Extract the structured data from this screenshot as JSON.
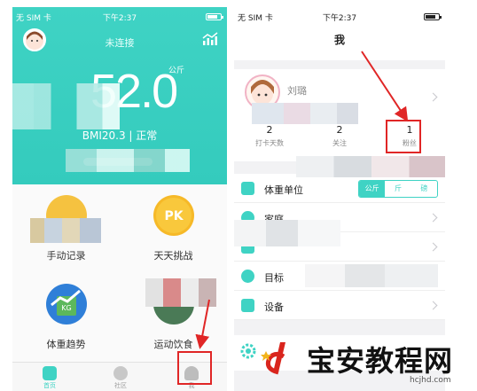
{
  "left": {
    "status": {
      "carrier": "无 SIM 卡",
      "time": "下午2:37"
    },
    "connection": "未连接",
    "weight": "52.0",
    "unit": "公斤",
    "bmi": "BMI20.3 | 正常",
    "grid": [
      {
        "label": "手动记录",
        "color": "#f5b830"
      },
      {
        "label": "天天挑战",
        "color": "#f2b122"
      },
      {
        "label": "体重趋势",
        "color": "#2f7fd8"
      },
      {
        "label": "运动饮食",
        "color": "#2f8f4a"
      }
    ],
    "tabs": [
      {
        "label": "首页",
        "active": true
      },
      {
        "label": "社区",
        "active": false
      },
      {
        "label": "我",
        "active": false
      }
    ]
  },
  "right": {
    "status": {
      "carrier": "无 SIM 卡",
      "time": "下午2:37"
    },
    "title": "我",
    "profile": {
      "name": "刘璐"
    },
    "stats": [
      {
        "value": "2",
        "key": "打卡天数"
      },
      {
        "value": "2",
        "key": "关注"
      },
      {
        "value": "1",
        "key": "粉丝"
      }
    ],
    "menu": [
      {
        "label": "体重单位",
        "icon": "kg-icon",
        "color": "#3fd3c4"
      },
      {
        "label": "家庭",
        "icon": "family-icon",
        "color": "#3fd3c4"
      },
      {
        "label": "",
        "icon": "hidden-icon",
        "color": "#3fd3c4"
      },
      {
        "label": "目标",
        "icon": "target-icon",
        "color": "#3fd3c4"
      },
      {
        "label": "设备",
        "icon": "device-icon",
        "color": "#3fd3c4"
      }
    ],
    "unit_seg": [
      "公斤",
      "斤",
      "磅"
    ]
  },
  "watermark": {
    "brand": "宝安教程网",
    "url": "hcjhd.com"
  },
  "colors": {
    "teal": "#3fd3c4",
    "red": "#e02626"
  }
}
